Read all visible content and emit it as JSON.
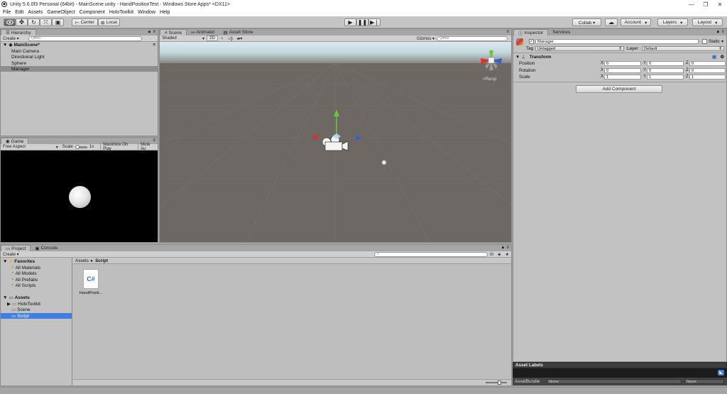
{
  "window": {
    "title": "Unity 5.6.0f3 Personal (64bit) - MainScene.unity - HandPositionTest - Windows Store Apps* <DX11>",
    "minimize": "—",
    "restore": "❐",
    "close": "✕"
  },
  "menu": [
    "File",
    "Edit",
    "Assets",
    "GameObject",
    "Component",
    "HoloToolkit",
    "Window",
    "Help"
  ],
  "toolbar": {
    "pivot": "Center",
    "space": "Local",
    "collab": "Collab ▾",
    "account": "Account",
    "layers": "Layers",
    "layout": "Layout"
  },
  "hierarchy": {
    "tab": "Hierarchy",
    "create": "Create ▾",
    "search_placeholder": "Q▾All",
    "scene_name": "MainScene*",
    "items": [
      "Main Camera",
      "Directional Light",
      "Sphere",
      "Manager"
    ],
    "selected_index": 3
  },
  "scene": {
    "tabs": [
      "Scene",
      "Animator",
      "Asset Store"
    ],
    "shading": "Shaded",
    "mode_2d": "2D",
    "gizmos": "Gizmos ▾",
    "search_placeholder": "Q▾All",
    "persp": "Persp"
  },
  "game": {
    "tab": "Game",
    "aspect": "Free Aspect",
    "scale_label": "Scale",
    "scale_value": "1x",
    "maximize": "Maximize On Play",
    "mute": "Mute Au"
  },
  "inspector": {
    "tabs": [
      "Inspector",
      "Services"
    ],
    "object_name": "Manager",
    "static_label": "Static",
    "tag_label": "Tag",
    "tag_value": "Untagged",
    "layer_label": "Layer",
    "layer_value": "Default",
    "component_title": "Transform",
    "rows": [
      {
        "label": "Position",
        "x": "0",
        "y": "0",
        "z": "0"
      },
      {
        "label": "Rotation",
        "x": "0",
        "y": "0",
        "z": "0"
      },
      {
        "label": "Scale",
        "x": "1",
        "y": "1",
        "z": "1"
      }
    ],
    "add_component": "Add Component",
    "asset_labels": "Asset Labels",
    "asset_bundle_label": "AssetBundle",
    "asset_bundle_value": "None",
    "asset_bundle_variant": "None"
  },
  "project": {
    "tabs": [
      "Project",
      "Console"
    ],
    "create": "Create ▾",
    "favorites_label": "Favorites",
    "favorites": [
      "All Materials",
      "All Models",
      "All Prefabs",
      "All Scripts"
    ],
    "assets_label": "Assets",
    "folders": [
      "HoloToolkit",
      "Scene",
      "Script"
    ],
    "selected_folder_index": 2,
    "breadcrumb_root": "Assets",
    "breadcrumb_current": "Script",
    "files": [
      {
        "name": "HandPositi...",
        "type": "C#"
      }
    ]
  },
  "colors": {
    "selection": "#3d80df",
    "x_axis": "#d2352b",
    "y_axis": "#6ac53a",
    "z_axis": "#3461d1"
  }
}
